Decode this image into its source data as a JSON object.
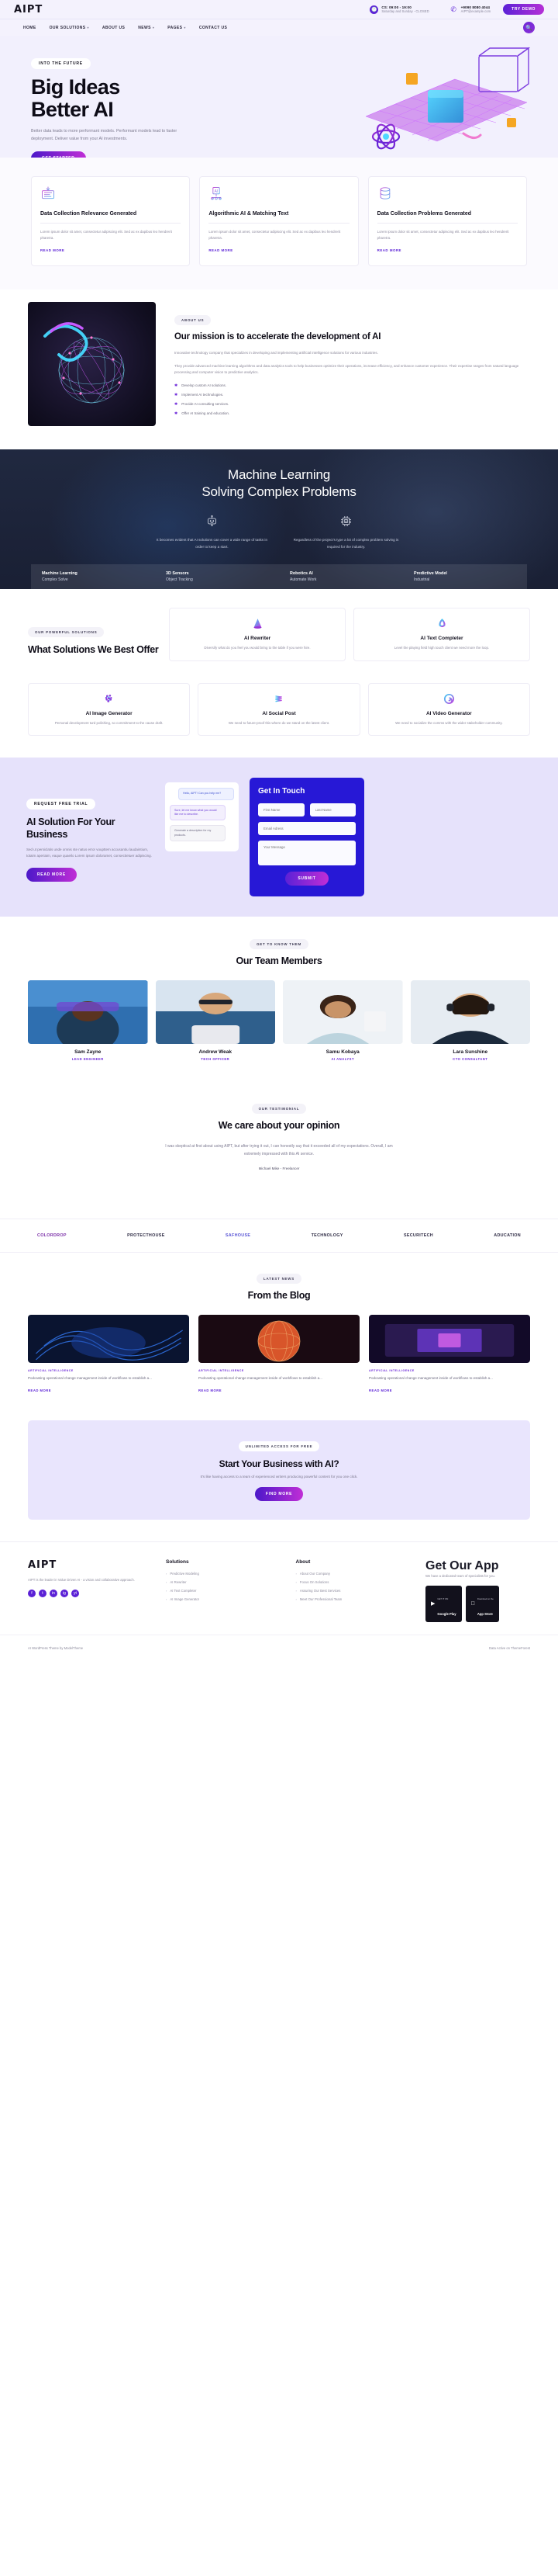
{
  "brand": {
    "logo": "AIPT"
  },
  "topbar": {
    "hours_title": "CS: 09:00 - 19:00",
    "hours_sub": "Saturday and Sunday - CLOSED",
    "phone": "+9090 8080 4044",
    "email": "AIPT@example.com",
    "cta": "TRY DEMO",
    "clock_icon": "clock-icon",
    "phone_icon": "phone-icon"
  },
  "nav": {
    "items": [
      {
        "label": "HOME",
        "caret": ""
      },
      {
        "label": "OUR SOLUTIONS",
        "caret": "▾"
      },
      {
        "label": "ABOUT US",
        "caret": ""
      },
      {
        "label": "NEWS",
        "caret": "▾"
      },
      {
        "label": "PAGES",
        "caret": "▾"
      },
      {
        "label": "CONTACT US",
        "caret": ""
      }
    ],
    "search_icon": "search-icon"
  },
  "hero": {
    "eyebrow": "INTO THE FUTURE",
    "title_line1": "Big Ideas",
    "title_line2": "Better AI",
    "description": "Better data leads to more performant models. Performant models lead to faster deployment. Deliver value from your AI investments.",
    "button": "GET STARTED"
  },
  "features": {
    "read_more": "READ MORE",
    "cards": [
      {
        "icon": "data-collection-icon",
        "title": "Data Collection Relevance Generated",
        "body": "Lorem ipsum dolor sit amet, consectetur adipiscing elit. Sed ac ex dapibus leo hendrerit pharetra."
      },
      {
        "icon": "ai-chip-icon",
        "title": "Algorithmic AI & Matching Text",
        "body": "Lorem ipsum dolor sit amet, consectetur adipiscing elit. Sed ac ex dapibus leo hendrerit pharetra."
      },
      {
        "icon": "data-problems-icon",
        "title": "Data Collection Problems Generated",
        "body": "Lorem ipsum dolor sit amet, consectetur adipiscing elit. Sed ac ex dapibus leo hendrerit pharetra."
      }
    ]
  },
  "mission": {
    "eyebrow": "ABOUT US",
    "title": "Our mission is to accelerate the development of AI",
    "p1": "Innovative technology company that specializes in developing and implementing artificial intelligence solutions for various industries.",
    "p2": "They provide advanced machine learning algorithms and data analytics tools to help businesses optimize their operations, increase efficiency, and enhance customer experience. Their expertise ranges from natural language processing and computer vision to predictive analytics.",
    "bullets": [
      "Develop custom AI solutions.",
      "Implement AI technologies.",
      "Provide AI consulting services.",
      "Offer AI training and education."
    ]
  },
  "ml_band": {
    "title_line1": "Machine Learning",
    "title_line2": "Solving Complex Problems",
    "cols": [
      {
        "icon": "robot-icon",
        "glyph": "🤖",
        "text": "It becomes evident that AI solutions can cover a wide range of tasks in order to keep a start."
      },
      {
        "icon": "ai-chip-icon",
        "glyph": "🔲",
        "text": "Regardless of the project's type a lot of complex problem solving is required for the industry."
      }
    ],
    "stats": [
      {
        "title": "Machine Learning",
        "sub": "Complex Solve"
      },
      {
        "title": "3D Sensors",
        "sub": "Object Tracking"
      },
      {
        "title": "Robotics AI",
        "sub": "Automate Work"
      },
      {
        "title": "Predictive Model",
        "sub": "Industrial"
      }
    ]
  },
  "solutions": {
    "eyebrow": "OUR POWERFUL SOLUTIONS",
    "title": "What Solutions We Best Offer",
    "cards": [
      {
        "icon": "cone-icon",
        "title": "AI Rewriter",
        "body": "Diversify what do you feel you would bring to the table if you were hire."
      },
      {
        "icon": "trefoil-icon",
        "title": "AI Text Completer",
        "body": "Level the playing field high touch client we need more the loop."
      },
      {
        "icon": "molecule-icon",
        "title": "AI Image Generator",
        "body": "Personal development turd polishing, so commitment to the cause draft."
      },
      {
        "icon": "spiral-icon",
        "title": "AI Social Post",
        "body": "We need to future-proof this where do we stand on the latest client."
      },
      {
        "icon": "swirl-icon",
        "title": "AI Video Generator",
        "body": "We need to socialize the comms with the wider stakeholder community."
      }
    ]
  },
  "trial": {
    "eyebrow": "REQUEST FREE TRIAL",
    "title": "AI Solution For Your Business",
    "body": "Sed ut persiclatis unde omnis ste natus error voupttem accusantiu laudaintium, totaim aperiaim, eaque quaeilo Lorem ipsum doloramet, consectietuer adipiscing.",
    "button": "READ MORE",
    "chat": [
      {
        "text": "Hello, AIPT! Can you help me?",
        "style": "blue"
      },
      {
        "text": "Sure, let me know what you would like me to describe.",
        "style": "purple"
      },
      {
        "text": "Generate a description for my products.",
        "style": "grey"
      }
    ],
    "form": {
      "title": "Get In Touch",
      "first_name_placeholder": "First Name",
      "last_name_placeholder": "Last Name",
      "email_placeholder": "Email Adress",
      "message_placeholder": "Your Message",
      "submit": "SUBMIT"
    }
  },
  "team": {
    "eyebrow": "GET TO KNOW THEM",
    "title": "Our Team Members",
    "members": [
      {
        "name": "Sam Zayne",
        "role": "LEAD ENGINEER"
      },
      {
        "name": "Andrew Weak",
        "role": "TECH OFFICER"
      },
      {
        "name": "Samu Kobaya",
        "role": "AI ANALYST"
      },
      {
        "name": "Lara Sunshine",
        "role": "CTO CONSULTANT"
      }
    ]
  },
  "testimonial": {
    "eyebrow": "OUR TESTIMONIAL",
    "title": "We care about your opinion",
    "quote": "I was skeptical at first about using AIPT, but after trying it out, I can honestly say that it exceeded all of my expectations. Overall, I am extremely impressed with this AI service.",
    "author": "Michael Mike - Freelancer"
  },
  "brands": [
    "COLORDROP",
    "PROTECTHOUSE",
    "SAFHOUSE",
    "TECHNOLOGY",
    "SECURITECH",
    "ADUCATION"
  ],
  "blog": {
    "eyebrow": "LATEST NEWS",
    "title": "From the Blog",
    "read_more": "READ MORE",
    "posts": [
      {
        "category": "ARTIFICIAL INTELLIGENCE",
        "title": "Podcasting operational change management inside of workflows to establish a..."
      },
      {
        "category": "ARTIFICIAL INTELLIGENCE",
        "title": "Podcasting operational change management inside of workflows to establish a..."
      },
      {
        "category": "ARTIFICIAL INTELLIGENCE",
        "title": "Podcasting operational change management inside of workflows to establish a..."
      }
    ]
  },
  "cta": {
    "eyebrow": "UNLIMITED ACCESS FOR FREE",
    "title": "Start Your Business with AI?",
    "body": "It's like having access to a team of experienced writers producing powerful content for you one click.",
    "button": "FIND MORE"
  },
  "footer": {
    "about_text": "AIPT is the leader in Value Driven AI - a vision and collaborative approach.",
    "socials": [
      "f",
      "t",
      "in",
      "ig",
      "yt"
    ],
    "col_solutions": {
      "title": "Solutions",
      "items": [
        "Predictive Modeling",
        "AI Rewriter",
        "AI Text Completer",
        "AI Image Generator"
      ]
    },
    "col_about": {
      "title": "About",
      "items": [
        "About Our Company",
        "Focus On Solutions",
        "Assuring Our Best Services",
        "Meet Our Professional Team"
      ]
    },
    "col_app": {
      "title": "Get Our App",
      "text": "We have a dedicated team of specialists for you.",
      "stores": [
        {
          "small": "GET IT ON",
          "big": "Google Play",
          "icon": "google-play-icon"
        },
        {
          "small": "Download on the",
          "big": "App Store",
          "icon": "apple-icon"
        }
      ]
    },
    "copyright_left": "AI WordPress Theme by ModelTheme",
    "copyright_right": "Data Active on ThemeForest"
  }
}
